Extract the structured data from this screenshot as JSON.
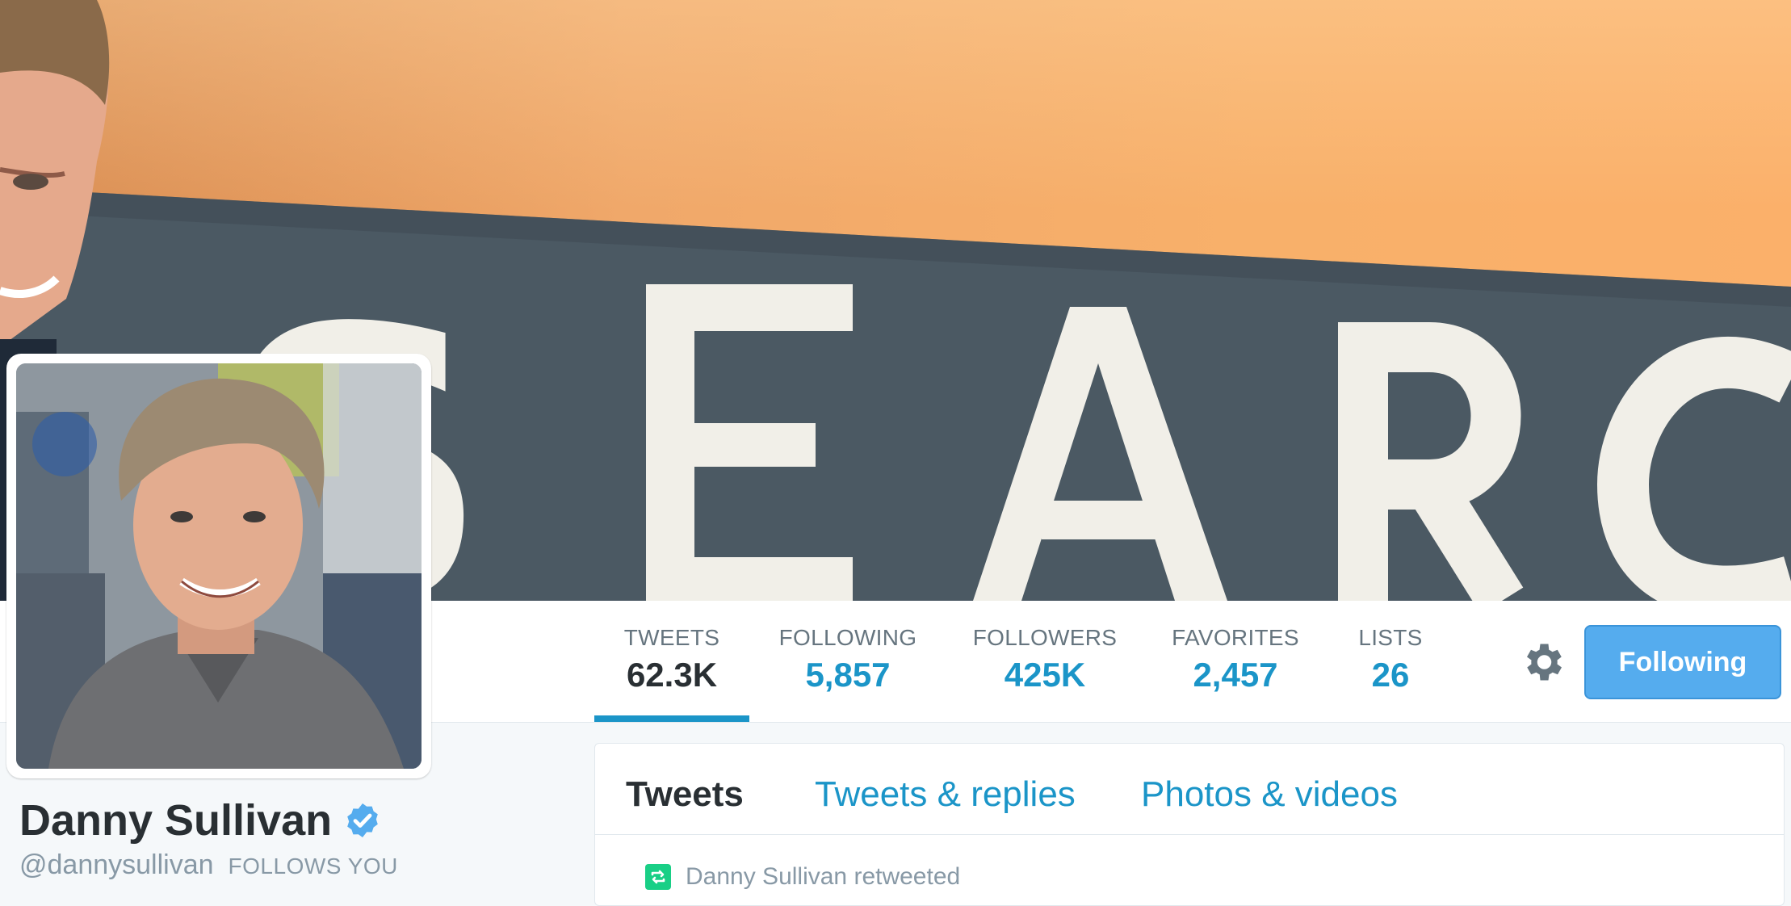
{
  "profile": {
    "name": "Danny Sullivan",
    "handle": "@dannysullivan",
    "follows_you": "FOLLOWS YOU"
  },
  "header": {
    "banner_text": "SEARC"
  },
  "stats": [
    {
      "label": "TWEETS",
      "value": "62.3K"
    },
    {
      "label": "FOLLOWING",
      "value": "5,857"
    },
    {
      "label": "FOLLOWERS",
      "value": "425K"
    },
    {
      "label": "FAVORITES",
      "value": "2,457"
    },
    {
      "label": "LISTS",
      "value": "26"
    }
  ],
  "actions": {
    "follow_button": "Following",
    "settings_icon": "gear-icon"
  },
  "timeline": {
    "tabs": [
      {
        "label": "Tweets"
      },
      {
        "label": "Tweets & replies"
      },
      {
        "label": "Photos & videos"
      }
    ],
    "retweet_notice": "Danny Sullivan retweeted"
  },
  "colors": {
    "link": "#1b95c8",
    "button": "#55acee",
    "retweet": "#19cf86",
    "text_dark": "#292f33",
    "text_muted": "#8899a6"
  }
}
